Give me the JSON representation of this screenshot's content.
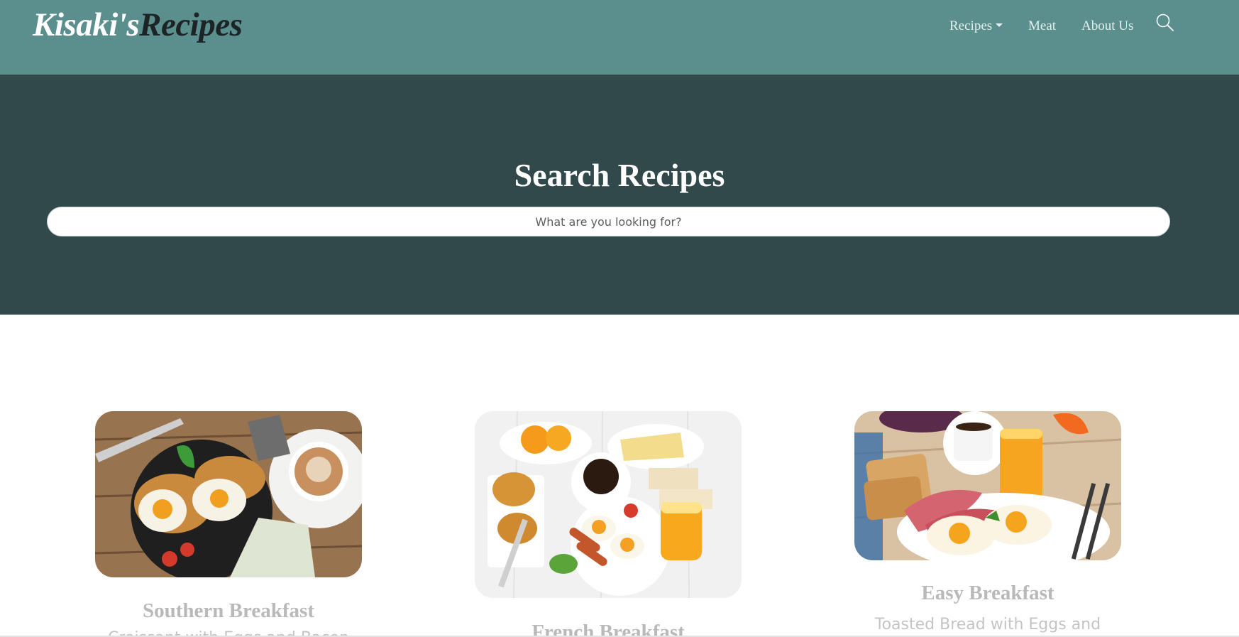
{
  "navbar": {
    "brand_part1": "Kisaki's",
    "brand_part2": "Recipes",
    "items": [
      {
        "label": "Recipes",
        "has_dropdown": true
      },
      {
        "label": "Meat"
      },
      {
        "label": "About Us"
      }
    ],
    "search_icon": "search-icon",
    "background_color": "#5a8f8e"
  },
  "hero": {
    "title": "Search Recipes",
    "search_placeholder": "What are you looking for?",
    "background_color": "#31494b"
  },
  "cards": [
    {
      "title": "Southern Breakfast",
      "description": "Croissant with Eggs and Bacon",
      "image": "breakfast-photo"
    },
    {
      "title": "French Breakfast",
      "description": "",
      "image": "breakfast-photo"
    },
    {
      "title": "Easy Breakfast",
      "description": "Toasted Bread with Eggs and",
      "image": "breakfast-photo"
    }
  ]
}
